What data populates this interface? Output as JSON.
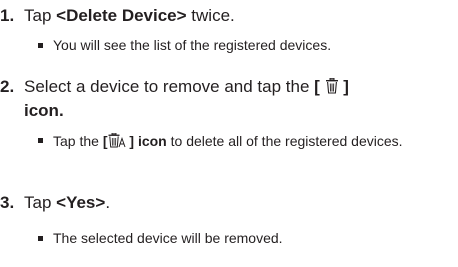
{
  "steps": [
    {
      "number": "1.",
      "prefix": "Tap ",
      "bold": "<Delete Device>",
      "suffix": " twice.",
      "note": "You will see the list of the registered devices."
    },
    {
      "number": "2.",
      "line1_prefix": "Select a device to remove and tap the ",
      "bracket_open": "[",
      "bracket_close": "]",
      "icon_name": "trash-icon",
      "line2_bold": "icon.",
      "note_prefix": "Tap the ",
      "note_bracket_open": "[",
      "note_bracket_close": " ]",
      "note_icon_name": "trash-all-icon",
      "note_bold_suffix": " icon",
      "note_suffix": " to delete all of the registered devices."
    },
    {
      "number": "3.",
      "prefix": "Tap ",
      "bold": "<Yes>",
      "suffix": ".",
      "note": "The selected device will be removed."
    }
  ]
}
